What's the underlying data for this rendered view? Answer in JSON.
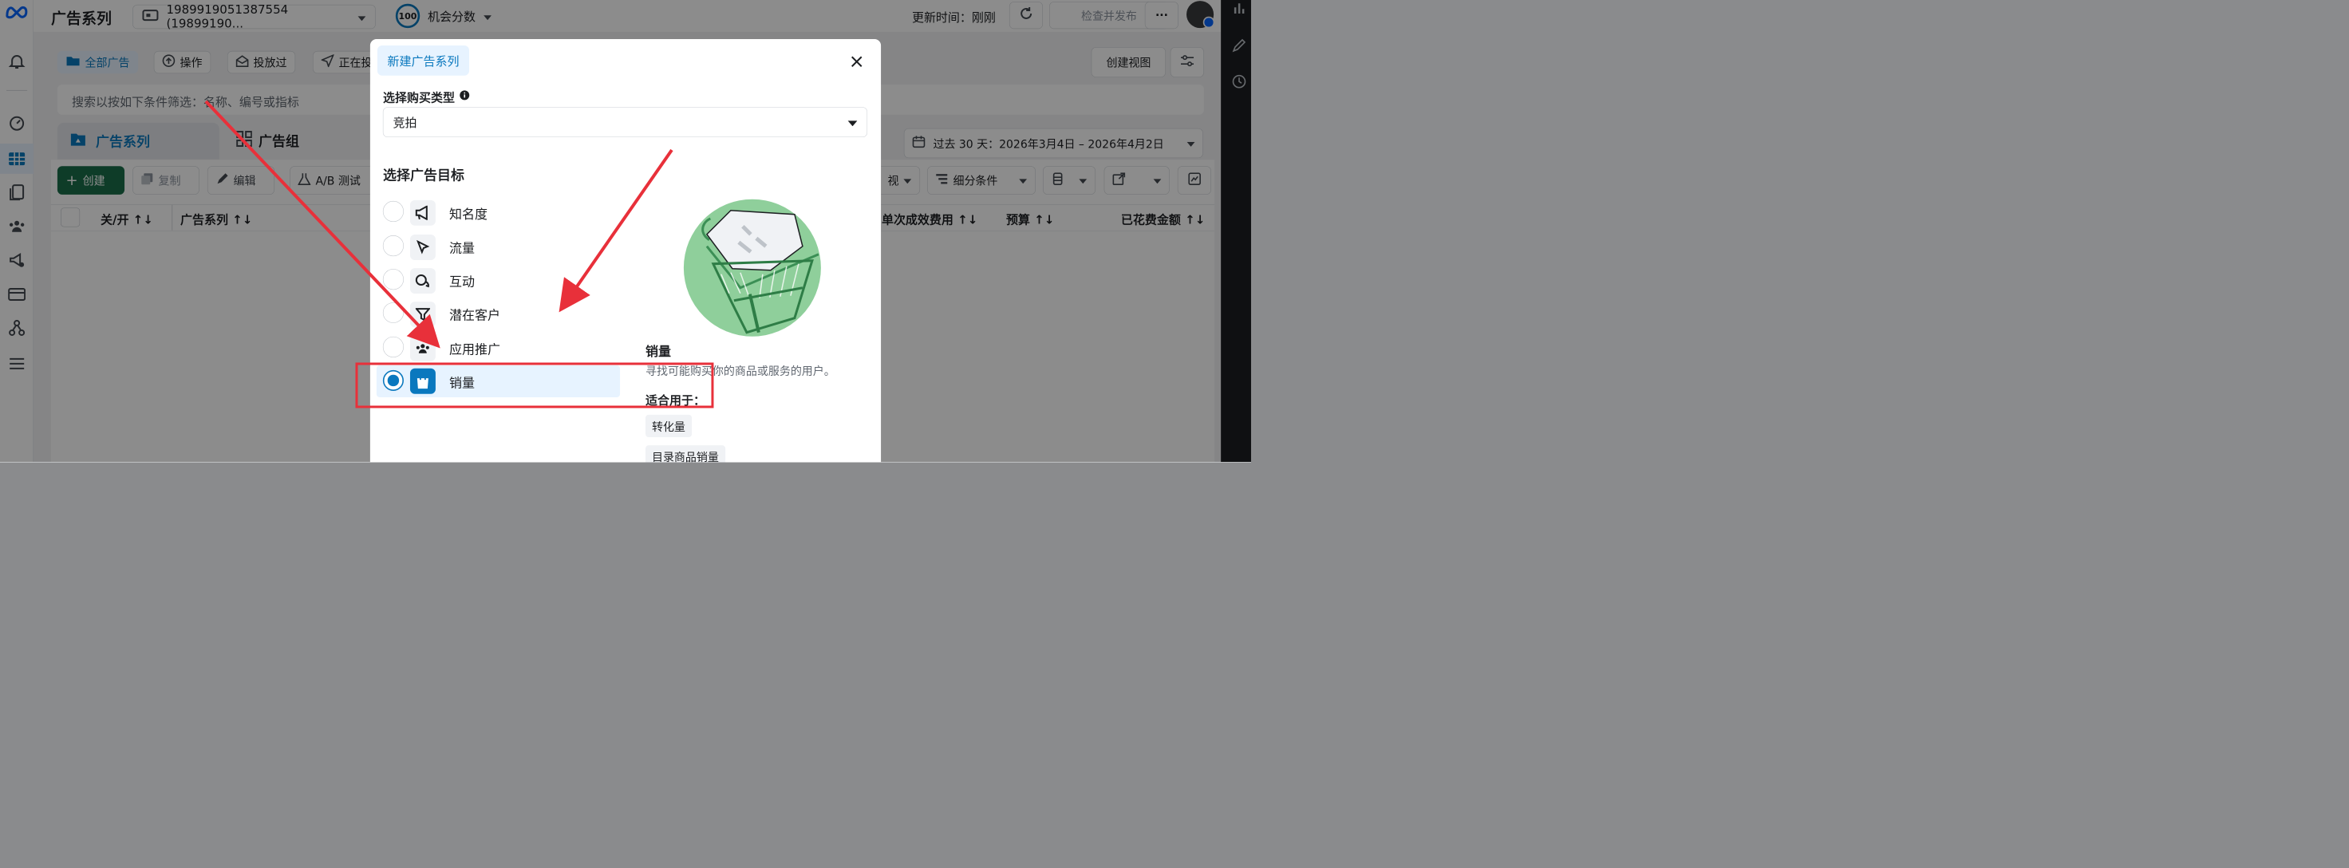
{
  "topbar": {
    "section_title": "广告系列",
    "account_label": "1989919051387554 (19899190...",
    "score_badge": "100",
    "score_label": "机会分数",
    "update_time": "更新时间：刚刚",
    "publish_button": "检查并发布",
    "more_label": "···"
  },
  "filters": {
    "all_ads": "全部广告",
    "actions": "操作",
    "delivered": "投放过",
    "active_prefix": "正在投",
    "create_view": "创建视图",
    "search_placeholder": "搜索以按如下条件筛选：名称、编号或指标"
  },
  "tabs": {
    "campaigns": "广告系列",
    "adsets": "广告组"
  },
  "date_range": "过去 30 天：2026年3月4日 – 2026年4月2日",
  "toolbar": {
    "create": "创建",
    "duplicate": "复制",
    "edit": "编辑",
    "ab_test": "A/B 测试",
    "view_suffix": "视",
    "breakdown": "细分条件"
  },
  "table_headers": [
    "关/开 ↑↓",
    "广告系列 ↑↓",
    "单次成效费用 ↑↓",
    "预算 ↑↓",
    "已花费金额 ↑↓"
  ],
  "modal": {
    "title_tab": "新建广告系列",
    "buy_type_label": "选择购买类型",
    "buy_type_value": "竞拍",
    "objective_heading": "选择广告目标",
    "objectives": [
      {
        "label": "知名度",
        "icon": "megaphone-icon"
      },
      {
        "label": "流量",
        "icon": "cursor-icon"
      },
      {
        "label": "互动",
        "icon": "chat-bubbles-icon"
      },
      {
        "label": "潜在客户",
        "icon": "funnel-icon"
      },
      {
        "label": "应用推广",
        "icon": "people-icon"
      },
      {
        "label": "销量",
        "icon": "shopping-bag-icon",
        "selected": true
      }
    ],
    "detail": {
      "title": "销量",
      "description": "寻找可能购买你的商品或服务的用户。",
      "good_for_label": "适合用于：",
      "tags": [
        "转化量",
        "目录商品销量"
      ]
    }
  },
  "colors": {
    "accent": "#0a78be",
    "create_green": "#1b6e4a",
    "annotation_red": "#e8303a",
    "illustration_green": "#8fcf9b"
  }
}
